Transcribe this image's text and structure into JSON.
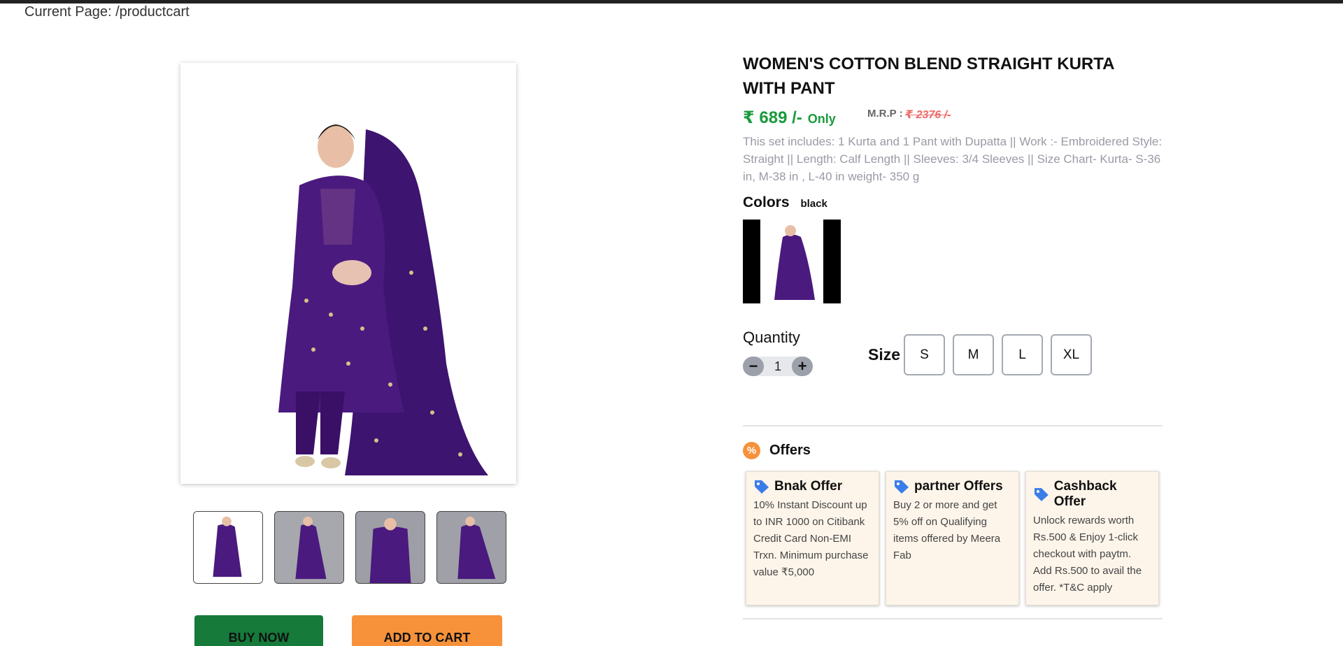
{
  "page": {
    "current_page_label": "Current Page: /productcart"
  },
  "product": {
    "title": "WOMEN'S COTTON BLEND STRAIGHT KURTA WITH PANT",
    "price": "₹ 689 /-",
    "price_suffix": "Only",
    "mrp_label": "M.R.P :",
    "mrp_value": "₹ 2376 /-",
    "description": "This set includes: 1 Kurta and 1 Pant with Dupatta || Work :- Embroidered Style: Straight || Length: Calf Length || Sleeves: 3/4 Sleeves || Size Chart- Kurta- S-36 in, M-38 in , L-40 in weight- 350 g",
    "garment_color": "#4a1a7e"
  },
  "colors": {
    "label": "Colors",
    "selected": "black"
  },
  "quantity": {
    "label": "Quantity",
    "value": "1",
    "decrement": "−",
    "increment": "+"
  },
  "size": {
    "label": "Size",
    "options": [
      "S",
      "M",
      "L",
      "XL"
    ]
  },
  "offers": {
    "title": "Offers",
    "badge": "%",
    "cards": [
      {
        "title": "Bnak Offer",
        "body": "10% Instant Discount up to INR 1000 on Citibank Credit Card Non-EMI Trxn. Minimum purchase value ₹5,000"
      },
      {
        "title": "partner Offers",
        "body": "Buy 2 or more and get 5% off on Qualifying items offered by Meera Fab"
      },
      {
        "title": "Cashback Offer",
        "body": "Unlock rewards worth Rs.500 & Enjoy 1-click checkout with paytm. Add Rs.500 to avail the offer. *T&C apply"
      }
    ]
  },
  "actions": {
    "buy_now": "BUY NOW",
    "add_to_cart": "ADD TO CART"
  },
  "colors_theme": {
    "price_green": "#1a9a3c",
    "buy_green": "#157a3a",
    "cart_orange": "#f8923a",
    "mrp_red": "#ef6a6a"
  }
}
